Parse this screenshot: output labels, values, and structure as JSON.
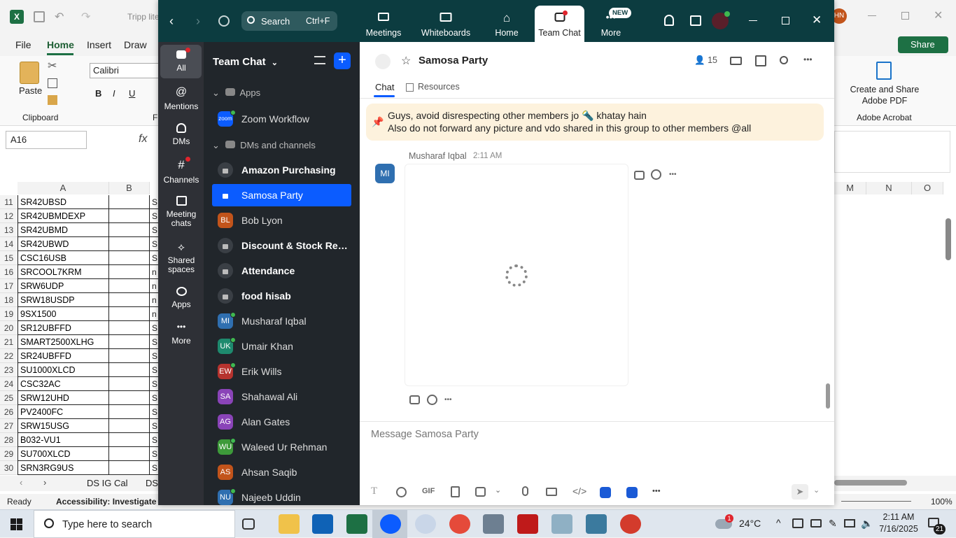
{
  "excel": {
    "title": "Tripp lite",
    "menu": [
      "File",
      "Home",
      "Insert",
      "Draw"
    ],
    "font_name": "Calibri",
    "name_box": "A16",
    "clipboard_label": "Clipboard",
    "paste_label": "Paste",
    "font_group_label": "F",
    "create_share_label": "Create and Share Adobe PDF",
    "adobe_label": "Adobe Acrobat",
    "share_label": "Share",
    "user_initials": "HN",
    "col_headers": [
      "A",
      "B",
      "M",
      "N",
      "O"
    ],
    "rows": [
      {
        "n": "11",
        "a": "SR42UBSD",
        "c": "S"
      },
      {
        "n": "12",
        "a": "SR42UBMDEXP",
        "c": "S"
      },
      {
        "n": "13",
        "a": "SR42UBMD",
        "c": "S"
      },
      {
        "n": "14",
        "a": "SR42UBWD",
        "c": "S"
      },
      {
        "n": "15",
        "a": "CSC16USB",
        "c": "S"
      },
      {
        "n": "16",
        "a": "SRCOOL7KRM",
        "c": "n"
      },
      {
        "n": "17",
        "a": "SRW6UDP",
        "c": "n"
      },
      {
        "n": "18",
        "a": "SRW18USDP",
        "c": "n"
      },
      {
        "n": "19",
        "a": "9SX1500",
        "c": "n"
      },
      {
        "n": "20",
        "a": "SR12UBFFD",
        "c": "S"
      },
      {
        "n": "21",
        "a": "SMART2500XLHG",
        "c": "S"
      },
      {
        "n": "22",
        "a": "SR24UBFFD",
        "c": "S"
      },
      {
        "n": "23",
        "a": "SU1000XLCD",
        "c": "S"
      },
      {
        "n": "24",
        "a": "CSC32AC",
        "c": "S"
      },
      {
        "n": "25",
        "a": "SRW12UHD",
        "c": "S"
      },
      {
        "n": "26",
        "a": "PV2400FC",
        "c": "S"
      },
      {
        "n": "27",
        "a": "SRW15USG",
        "c": "S"
      },
      {
        "n": "28",
        "a": "B032-VU1",
        "c": "S"
      },
      {
        "n": "29",
        "a": "SU700XLCD",
        "c": "S"
      },
      {
        "n": "30",
        "a": "SRN3RG9US",
        "c": "S"
      }
    ],
    "sheet_tabs": [
      "DS IG Cal",
      "DS"
    ],
    "status_ready": "Ready",
    "accessibility": "Accessibility: Investigate",
    "zoom_pct": "100%"
  },
  "zoom": {
    "search_label": "Search",
    "search_shortcut": "Ctrl+F",
    "tabs": [
      "Meetings",
      "Whiteboards",
      "Home",
      "Team Chat",
      "More"
    ],
    "new_badge": "NEW",
    "rail": [
      "All",
      "Mentions",
      "DMs",
      "Channels",
      "Meeting chats",
      "Shared spaces",
      "Apps",
      "More"
    ],
    "list_title": "Team Chat",
    "section_apps": "Apps",
    "zoom_workflow": "Zoom Workflow",
    "zoom_logo_text": "zoom",
    "section_dms": "DMs and channels",
    "items": [
      {
        "name": "Amazon Purchasing",
        "type": "lock",
        "bold": true
      },
      {
        "name": "Samosa Party",
        "type": "lock",
        "selected": true
      },
      {
        "name": "Bob Lyon",
        "type": "av",
        "initials": "BL",
        "color": "#c2541b",
        "online": false
      },
      {
        "name": "Discount & Stock Res...",
        "type": "lock",
        "bold": true
      },
      {
        "name": "Attendance",
        "type": "lock",
        "bold": true
      },
      {
        "name": "food hisab",
        "type": "lock",
        "bold": true
      },
      {
        "name": "Musharaf Iqbal",
        "type": "av",
        "initials": "MI",
        "color": "#2f6fb0",
        "online": true
      },
      {
        "name": "Umair Khan",
        "type": "av",
        "initials": "UK",
        "color": "#1e8a6e",
        "online": true
      },
      {
        "name": "Erik Wills",
        "type": "av",
        "initials": "EW",
        "color": "#b6332e",
        "online": true
      },
      {
        "name": "Shahawal Ali",
        "type": "av",
        "initials": "SA",
        "color": "#8a44b8",
        "online": false
      },
      {
        "name": "Alan Gates",
        "type": "av",
        "initials": "AG",
        "color": "#8a44b8",
        "online": false
      },
      {
        "name": "Waleed Ur Rehman",
        "type": "av",
        "initials": "WU",
        "color": "#3d9a3a",
        "online": true
      },
      {
        "name": "Ahsan Saqib",
        "type": "av",
        "initials": "AS",
        "color": "#c2541b",
        "online": false
      },
      {
        "name": "Najeeb Uddin",
        "type": "av",
        "initials": "NU",
        "color": "#2f6fb0",
        "online": true
      }
    ],
    "channel_name": "Samosa Party",
    "member_count": "15",
    "chat_tabs": [
      "Chat",
      "Resources"
    ],
    "pinned_line1": "Guys, avoid disrespecting other members jo 🔦 khatay hain",
    "pinned_line2": "Also do not forward any picture and vdo shared in this group to other members @all",
    "sender": "Musharaf Iqbal",
    "sender_initials": "MI",
    "time": "2:11 AM",
    "composer_placeholder": "Message Samosa Party"
  },
  "taskbar": {
    "search_placeholder": "Type here to search",
    "temperature": "24°C",
    "weather_badge": "1",
    "time": "2:11 AM",
    "date": "7/16/2025",
    "notif_count": "21"
  }
}
